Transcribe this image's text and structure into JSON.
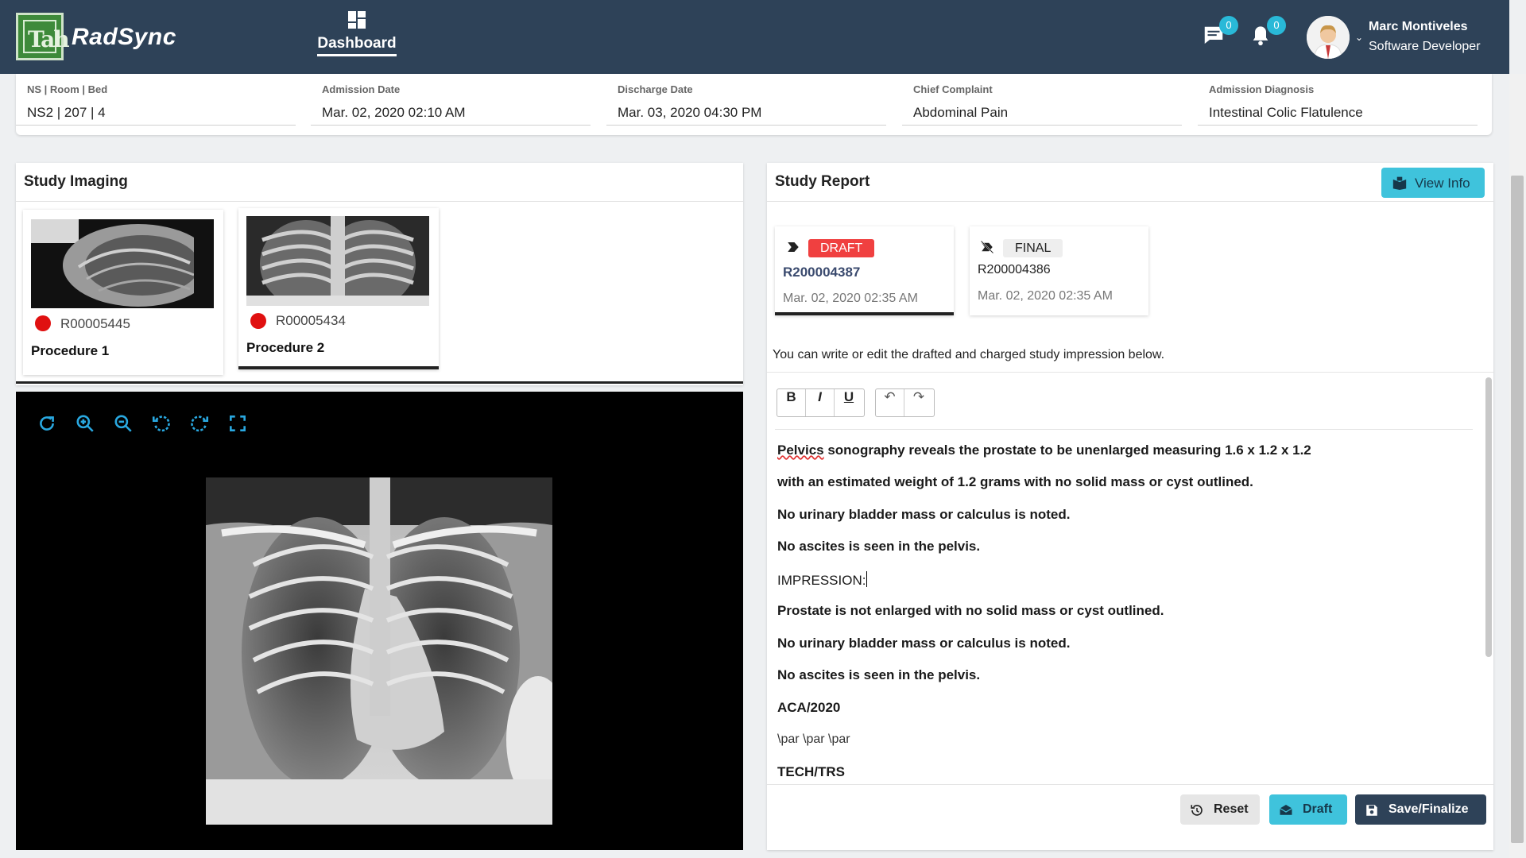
{
  "app": {
    "brand": "RadSync",
    "nav_label": "Dashboard"
  },
  "header": {
    "chat_count": "0",
    "notification_count": "0",
    "user_name": "Marc Montiveles",
    "user_role": "Software Developer"
  },
  "patient_info": [
    {
      "label": "NS | Room | Bed",
      "value": "NS2 | 207 | 4"
    },
    {
      "label": "Admission Date",
      "value": "Mar. 02, 2020 02:10 AM"
    },
    {
      "label": "Discharge Date",
      "value": "Mar. 03, 2020 04:30 PM"
    },
    {
      "label": "Chief Complaint",
      "value": "Abdominal Pain"
    },
    {
      "label": "Admission Diagnosis",
      "value": "Intestinal Colic Flatulence"
    }
  ],
  "imaging": {
    "title": "Study Imaging",
    "thumbnails": [
      {
        "id": "R00005445",
        "procedure": "Procedure 1",
        "selected": false
      },
      {
        "id": "R00005434",
        "procedure": "Procedure 2",
        "selected": true
      }
    ],
    "tools": [
      "refresh-icon",
      "zoom-in-icon",
      "zoom-out-icon",
      "rotate-left-icon",
      "rotate-right-icon",
      "fullscreen-icon"
    ]
  },
  "report": {
    "title": "Study Report",
    "view_info_label": "View Info",
    "reports": [
      {
        "status": "DRAFT",
        "id": "R200004387",
        "date": "Mar. 02, 2020 02:35 AM",
        "selected": true
      },
      {
        "status": "FINAL",
        "id": "R200004386",
        "date": "Mar. 02, 2020 02:35 AM",
        "selected": false
      }
    ],
    "hint": "You can write or edit the drafted and charged study impression below.",
    "toolbar": {
      "bold": "B",
      "italic": "I",
      "underline": "U",
      "undo": "↶",
      "redo": "↷"
    },
    "lines": [
      {
        "prefix": "Pelvics",
        "text": " sonography reveals the prostate to be unenlarged measuring 1.6 x 1.2 x 1.2"
      },
      {
        "text": "with an estimated weight of 1.2 grams with no solid mass or cyst outlined."
      },
      {
        "text": "No urinary bladder mass or calculus is noted."
      },
      {
        "text": "No ascites is seen in the pelvis."
      },
      {
        "text": "IMPRESSION:"
      },
      {
        "text": "Prostate is not enlarged with no solid mass or cyst outlined."
      },
      {
        "text": "No urinary bladder mass or calculus is noted."
      },
      {
        "text": "No ascites is seen in the pelvis."
      },
      {
        "text": "ACA/2020"
      },
      {
        "text": "\\par \\par \\par"
      },
      {
        "text": "TECH/TRS"
      }
    ],
    "actions": {
      "reset": "Reset",
      "draft": "Draft",
      "save": "Save/Finalize"
    }
  },
  "colors": {
    "header": "#2e4258",
    "accent": "#3fc3dc",
    "draft_tag": "#f04040",
    "save_btn": "#2e4258"
  }
}
